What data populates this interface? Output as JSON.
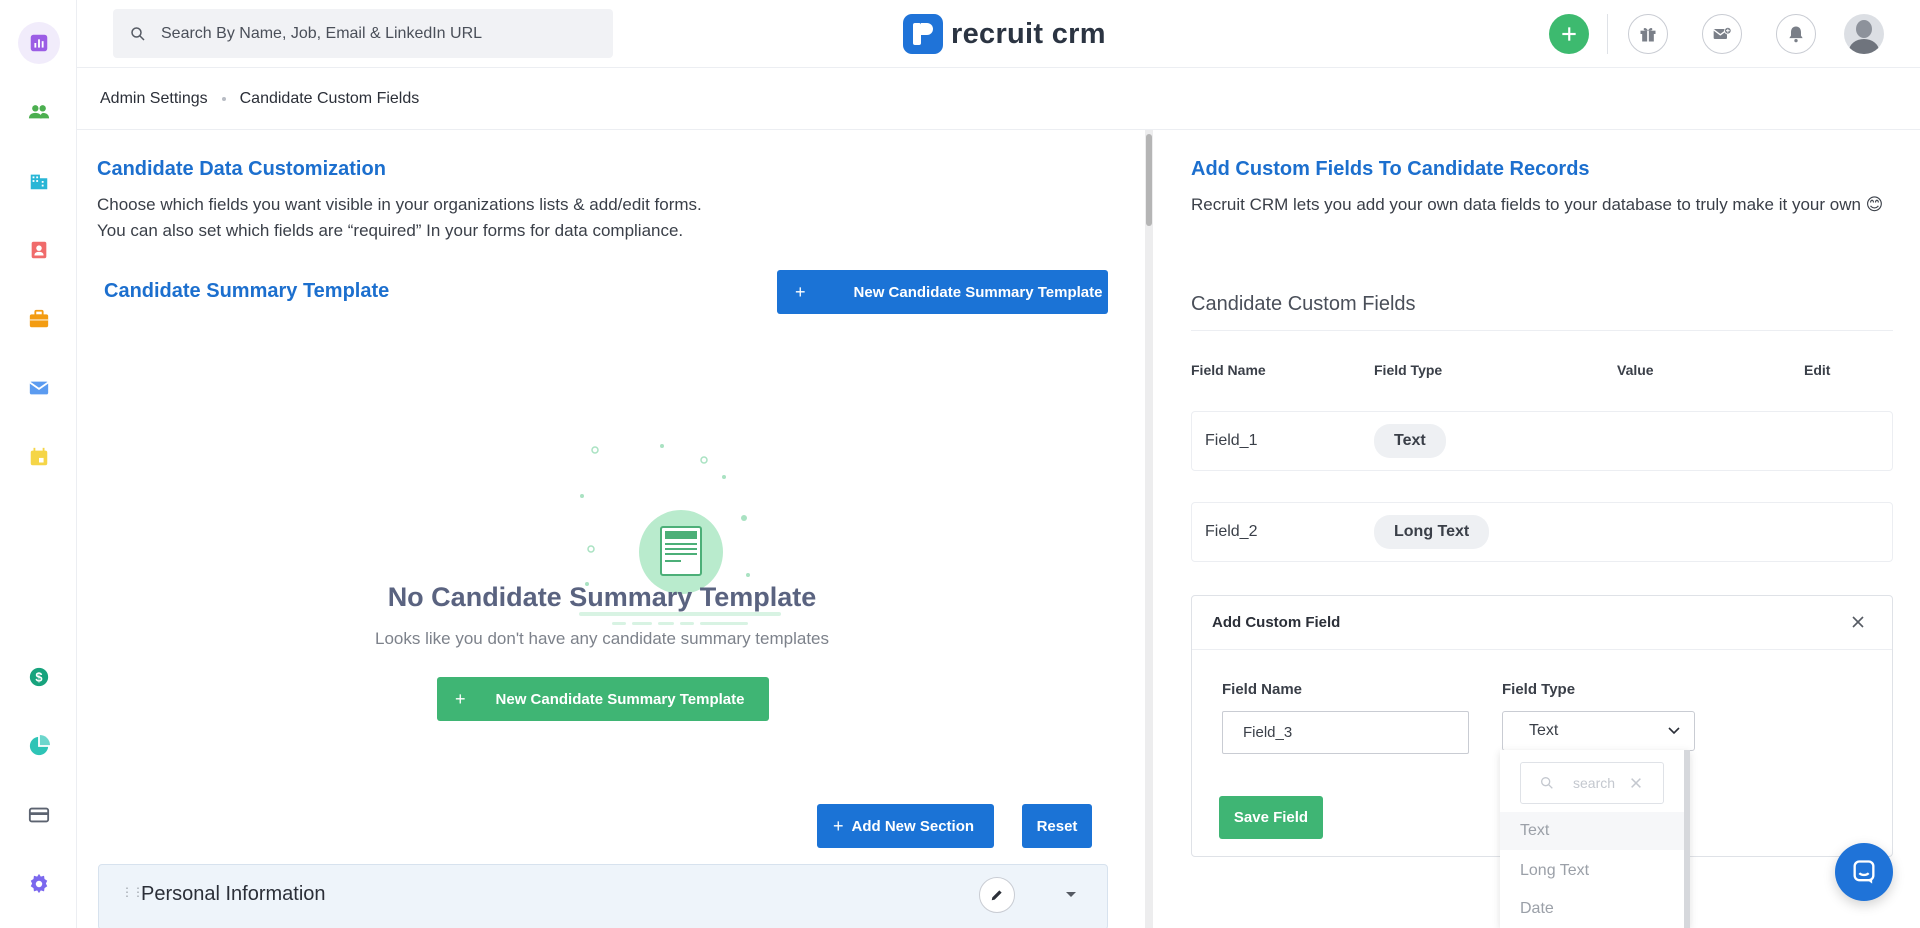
{
  "search": {
    "placeholder": "Search By Name, Job, Email & LinkedIn URL"
  },
  "brand": {
    "name": "recruit crm",
    "color": "#1f73d8"
  },
  "icons": {
    "sidebar": [
      "reports-icon",
      "candidates-icon",
      "companies-icon",
      "contacts-icon",
      "jobs-icon",
      "email-icon",
      "calendar-icon",
      "billing-icon",
      "analytics-icon",
      "card-icon",
      "settings-icon"
    ],
    "topbar": [
      "add-icon",
      "gift-icon",
      "mail-plus-icon",
      "bell-icon",
      "avatar"
    ]
  },
  "breadcrumb": {
    "root": "Admin Settings",
    "current": "Candidate Custom Fields"
  },
  "left": {
    "title": "Candidate Data Customization",
    "desc_line1": "Choose which fields you want visible in your organizations lists & add/edit forms.",
    "desc_line2": "You can also set which fields are “required” In your forms for data compliance.",
    "summary_title": "Candidate Summary Template",
    "new_template_button": "New Candidate Summary Template",
    "empty_title": "No Candidate Summary Template",
    "empty_subtitle": "Looks like you don't have any candidate summary templates",
    "empty_button": "New Candidate Summary Template",
    "add_section_button": "Add New Section",
    "reset_button": "Reset",
    "section_name": "Personal Information"
  },
  "right": {
    "title": "Add Custom Fields To Candidate Records",
    "desc": "Recruit CRM lets you add your own data fields to your database to truly make it your own",
    "emoji": "😊",
    "section_title": "Candidate Custom Fields",
    "columns": [
      "Field Name",
      "Field Type",
      "Value",
      "Edit"
    ],
    "rows": [
      {
        "name": "Field_1",
        "type": "Text"
      },
      {
        "name": "Field_2",
        "type": "Long Text"
      }
    ],
    "modal": {
      "title": "Add Custom Field",
      "field_name_label": "Field Name",
      "field_name_value": "Field_3",
      "field_type_label": "Field Type",
      "field_type_value": "Text",
      "save_button": "Save Field"
    },
    "dropdown": {
      "search_placeholder": "search",
      "options": [
        "Text",
        "Long Text",
        "Date"
      ]
    }
  },
  "colors": {
    "primary": "#1b73d6",
    "green": "#3fb574",
    "heading_blue": "#1c6fce"
  }
}
